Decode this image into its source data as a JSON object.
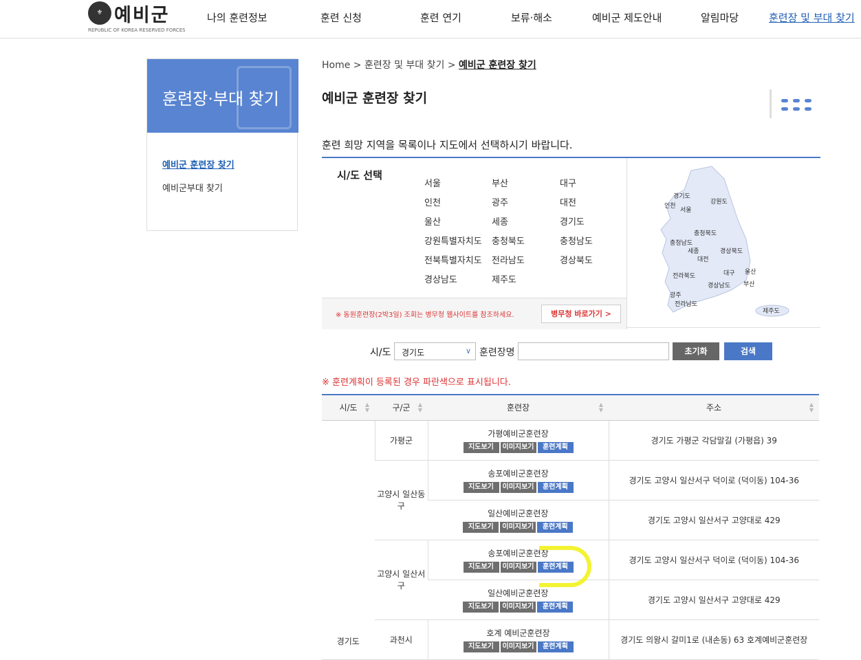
{
  "header": {
    "logo_text": "예비군",
    "logo_sub": "REPUBLIC OF KOREA RESERVED FORCES",
    "nav": [
      "나의 훈련정보",
      "훈련 신청",
      "훈련 연기",
      "보류·해소",
      "예비군 제도안내",
      "알림마당",
      "훈련장 및 부대 찾기"
    ]
  },
  "sidebar": {
    "title": "훈련장·부대 찾기",
    "items": [
      "예비군 훈련장 찾기",
      "예비군부대 찾기"
    ]
  },
  "breadcrumb": {
    "home": "Home",
    "mid": "훈련장 및 부대 찾기",
    "cur": "예비군 훈련장 찾기",
    "sep": ">"
  },
  "page_title": "예비군 훈련장 찾기",
  "guide": "훈련 희망 지역을 목록이나 지도에서 선택하시기 바랍니다.",
  "region_select": {
    "label": "시/도 선택",
    "regions": [
      "서울",
      "부산",
      "대구",
      "인천",
      "광주",
      "대전",
      "울산",
      "세종",
      "경기도",
      "강원특별자치도",
      "충청북도",
      "충청남도",
      "전북특별자치도",
      "전라남도",
      "경상북도",
      "경상남도",
      "제주도"
    ],
    "note": "※ 동원훈련장(2박3일) 조회는 병무청 웹사이트를 참조하세요.",
    "mma_button": "병무청 바로가기 >"
  },
  "map_labels": [
    "경기도",
    "강원도",
    "인천",
    "서울",
    "충청북도",
    "충청남도",
    "세종",
    "대전",
    "경상북도",
    "대구",
    "울산",
    "전라북도",
    "경상남도",
    "부산",
    "광주",
    "전라남도",
    "제주도"
  ],
  "search": {
    "sido_label": "시/도",
    "sido_value": "경기도",
    "name_label": "훈련장명",
    "name_value": "",
    "reset": "초기화",
    "search": "검색"
  },
  "warning": "※ 훈련계획이 등록된 경우 파란색으로 표시됩니다.",
  "table": {
    "headers": [
      "시/도",
      "구/군",
      "훈련장",
      "주소"
    ],
    "sido": "경기도",
    "groups": [
      "가평군",
      "고양시 일산동구",
      "고양시 일산서구",
      "과천시"
    ],
    "rows": [
      {
        "name": "가평예비군훈련장",
        "addr": "경기도 가평군 각담말길 (가평읍) 39"
      },
      {
        "name": "송포예비군훈련장",
        "addr": "경기도 고양시 일산서구 덕이로 (덕이동) 104-36"
      },
      {
        "name": "일산예비군훈련장",
        "addr": "경기도 고양시 일산서구 고양대로 429"
      },
      {
        "name": "송포예비군훈련장",
        "addr": "경기도 고양시 일산서구 덕이로 (덕이동) 104-36"
      },
      {
        "name": "일산예비군훈련장",
        "addr": "경기도 고양시 일산서구 고양대로 429"
      },
      {
        "name": "호계 예비군훈련장",
        "addr": "경기도 의왕시 갈미1로 (내손동) 63 호계예비군훈련장"
      }
    ],
    "btn_map": "지도보기",
    "btn_image": "이미지보기",
    "btn_plan": "훈련계획"
  },
  "colors": {
    "accent": "#4a78c6",
    "sidebar_head": "#5884d1",
    "warning": "#dd3333",
    "highlight": "#f2f21e"
  }
}
